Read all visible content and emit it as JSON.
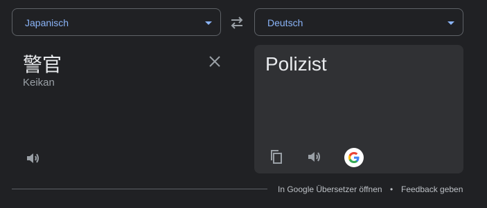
{
  "source_language": {
    "label": "Japanisch"
  },
  "target_language": {
    "label": "Deutsch"
  },
  "input": {
    "text": "警官",
    "transliteration": "Keikan"
  },
  "output": {
    "text": "Polizist"
  },
  "footer": {
    "open_link": "In Google Übersetzer öffnen",
    "separator": "•",
    "feedback_link": "Feedback geben"
  },
  "icons": {
    "swap": "swap-arrows-icon",
    "clear": "close-icon",
    "source_speaker": "speaker-icon",
    "copy": "copy-icon",
    "target_speaker": "speaker-icon",
    "google": "google-g-icon"
  },
  "colors": {
    "background": "#202124",
    "accent": "#8ab4f8",
    "panel": "#303134",
    "text_primary": "#e8eaed",
    "text_secondary": "#9aa0a6"
  }
}
